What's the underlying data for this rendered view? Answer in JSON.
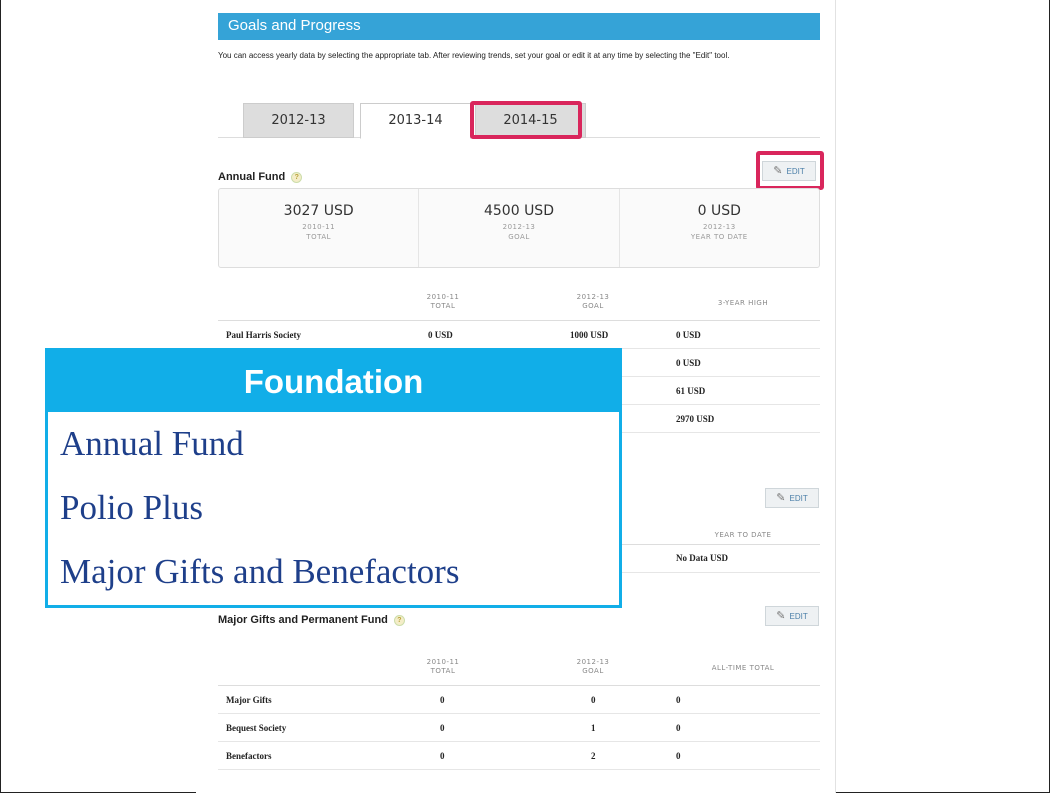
{
  "header": {
    "title": "Goals and Progress"
  },
  "intro": "You can access yearly data by selecting the appropriate tab. After reviewing trends, set your goal or edit it at any time by selecting the \"Edit\" tool.",
  "tabs": [
    {
      "label": "2012-13"
    },
    {
      "label": "2013-14"
    },
    {
      "label": "2014-15"
    }
  ],
  "annual_fund": {
    "title": "Annual Fund",
    "edit_label": "EDIT",
    "summary": [
      {
        "value": "3027 USD",
        "year": "2010-11",
        "caption": "TOTAL"
      },
      {
        "value": "4500 USD",
        "year": "2012-13",
        "caption": "GOAL"
      },
      {
        "value": "0 USD",
        "year": "2012-13",
        "caption": "YEAR TO DATE"
      }
    ],
    "columns": [
      {
        "year": "2010-11",
        "caption": "TOTAL"
      },
      {
        "year": "2012-13",
        "caption": "GOAL"
      },
      {
        "year": "",
        "caption": "3-YEAR HIGH"
      }
    ],
    "rows": [
      {
        "label": "Paul Harris Society",
        "total": "0 USD",
        "goal": "1000 USD",
        "high": "0 USD"
      },
      {
        "high": "0 USD"
      },
      {
        "high": "61 USD"
      },
      {
        "high": "2970 USD"
      }
    ]
  },
  "polio": {
    "edit_label": "EDIT",
    "column": "YEAR TO DATE",
    "value": "No Data USD"
  },
  "major_gifts": {
    "title": "Major Gifts and Permanent Fund",
    "edit_label": "EDIT",
    "columns": [
      {
        "year": "2010-11",
        "caption": "TOTAL"
      },
      {
        "year": "2012-13",
        "caption": "GOAL"
      },
      {
        "year": "",
        "caption": "ALL-TIME TOTAL"
      }
    ],
    "rows": [
      {
        "label": "Major Gifts",
        "total": "0",
        "goal": "0",
        "all": "0"
      },
      {
        "label": "Bequest Society",
        "total": "0",
        "goal": "1",
        "all": "0"
      },
      {
        "label": "Benefactors",
        "total": "0",
        "goal": "2",
        "all": "0"
      }
    ]
  },
  "overlay": {
    "title": "Foundation",
    "items": [
      "Annual Fund",
      "Polio Plus",
      "Major Gifts and Benefactors"
    ]
  },
  "colors": {
    "header": "#35a3d7",
    "highlight": "#d9265c",
    "overlay": "#11aee8",
    "overlay_text": "#1e3f8a"
  }
}
